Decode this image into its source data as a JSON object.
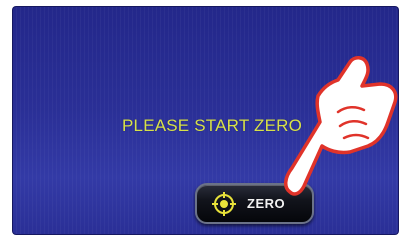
{
  "screen": {
    "message": "PLEASE START ZERO",
    "background_color": "#2a2f96",
    "message_color": "#d7e14a"
  },
  "zero_button": {
    "label": "ZERO",
    "icon": "target-crosshair-icon",
    "icon_color": "#e8e23a"
  },
  "overlay": {
    "icon": "pointing-hand-icon",
    "outline_color": "#e0332a"
  }
}
